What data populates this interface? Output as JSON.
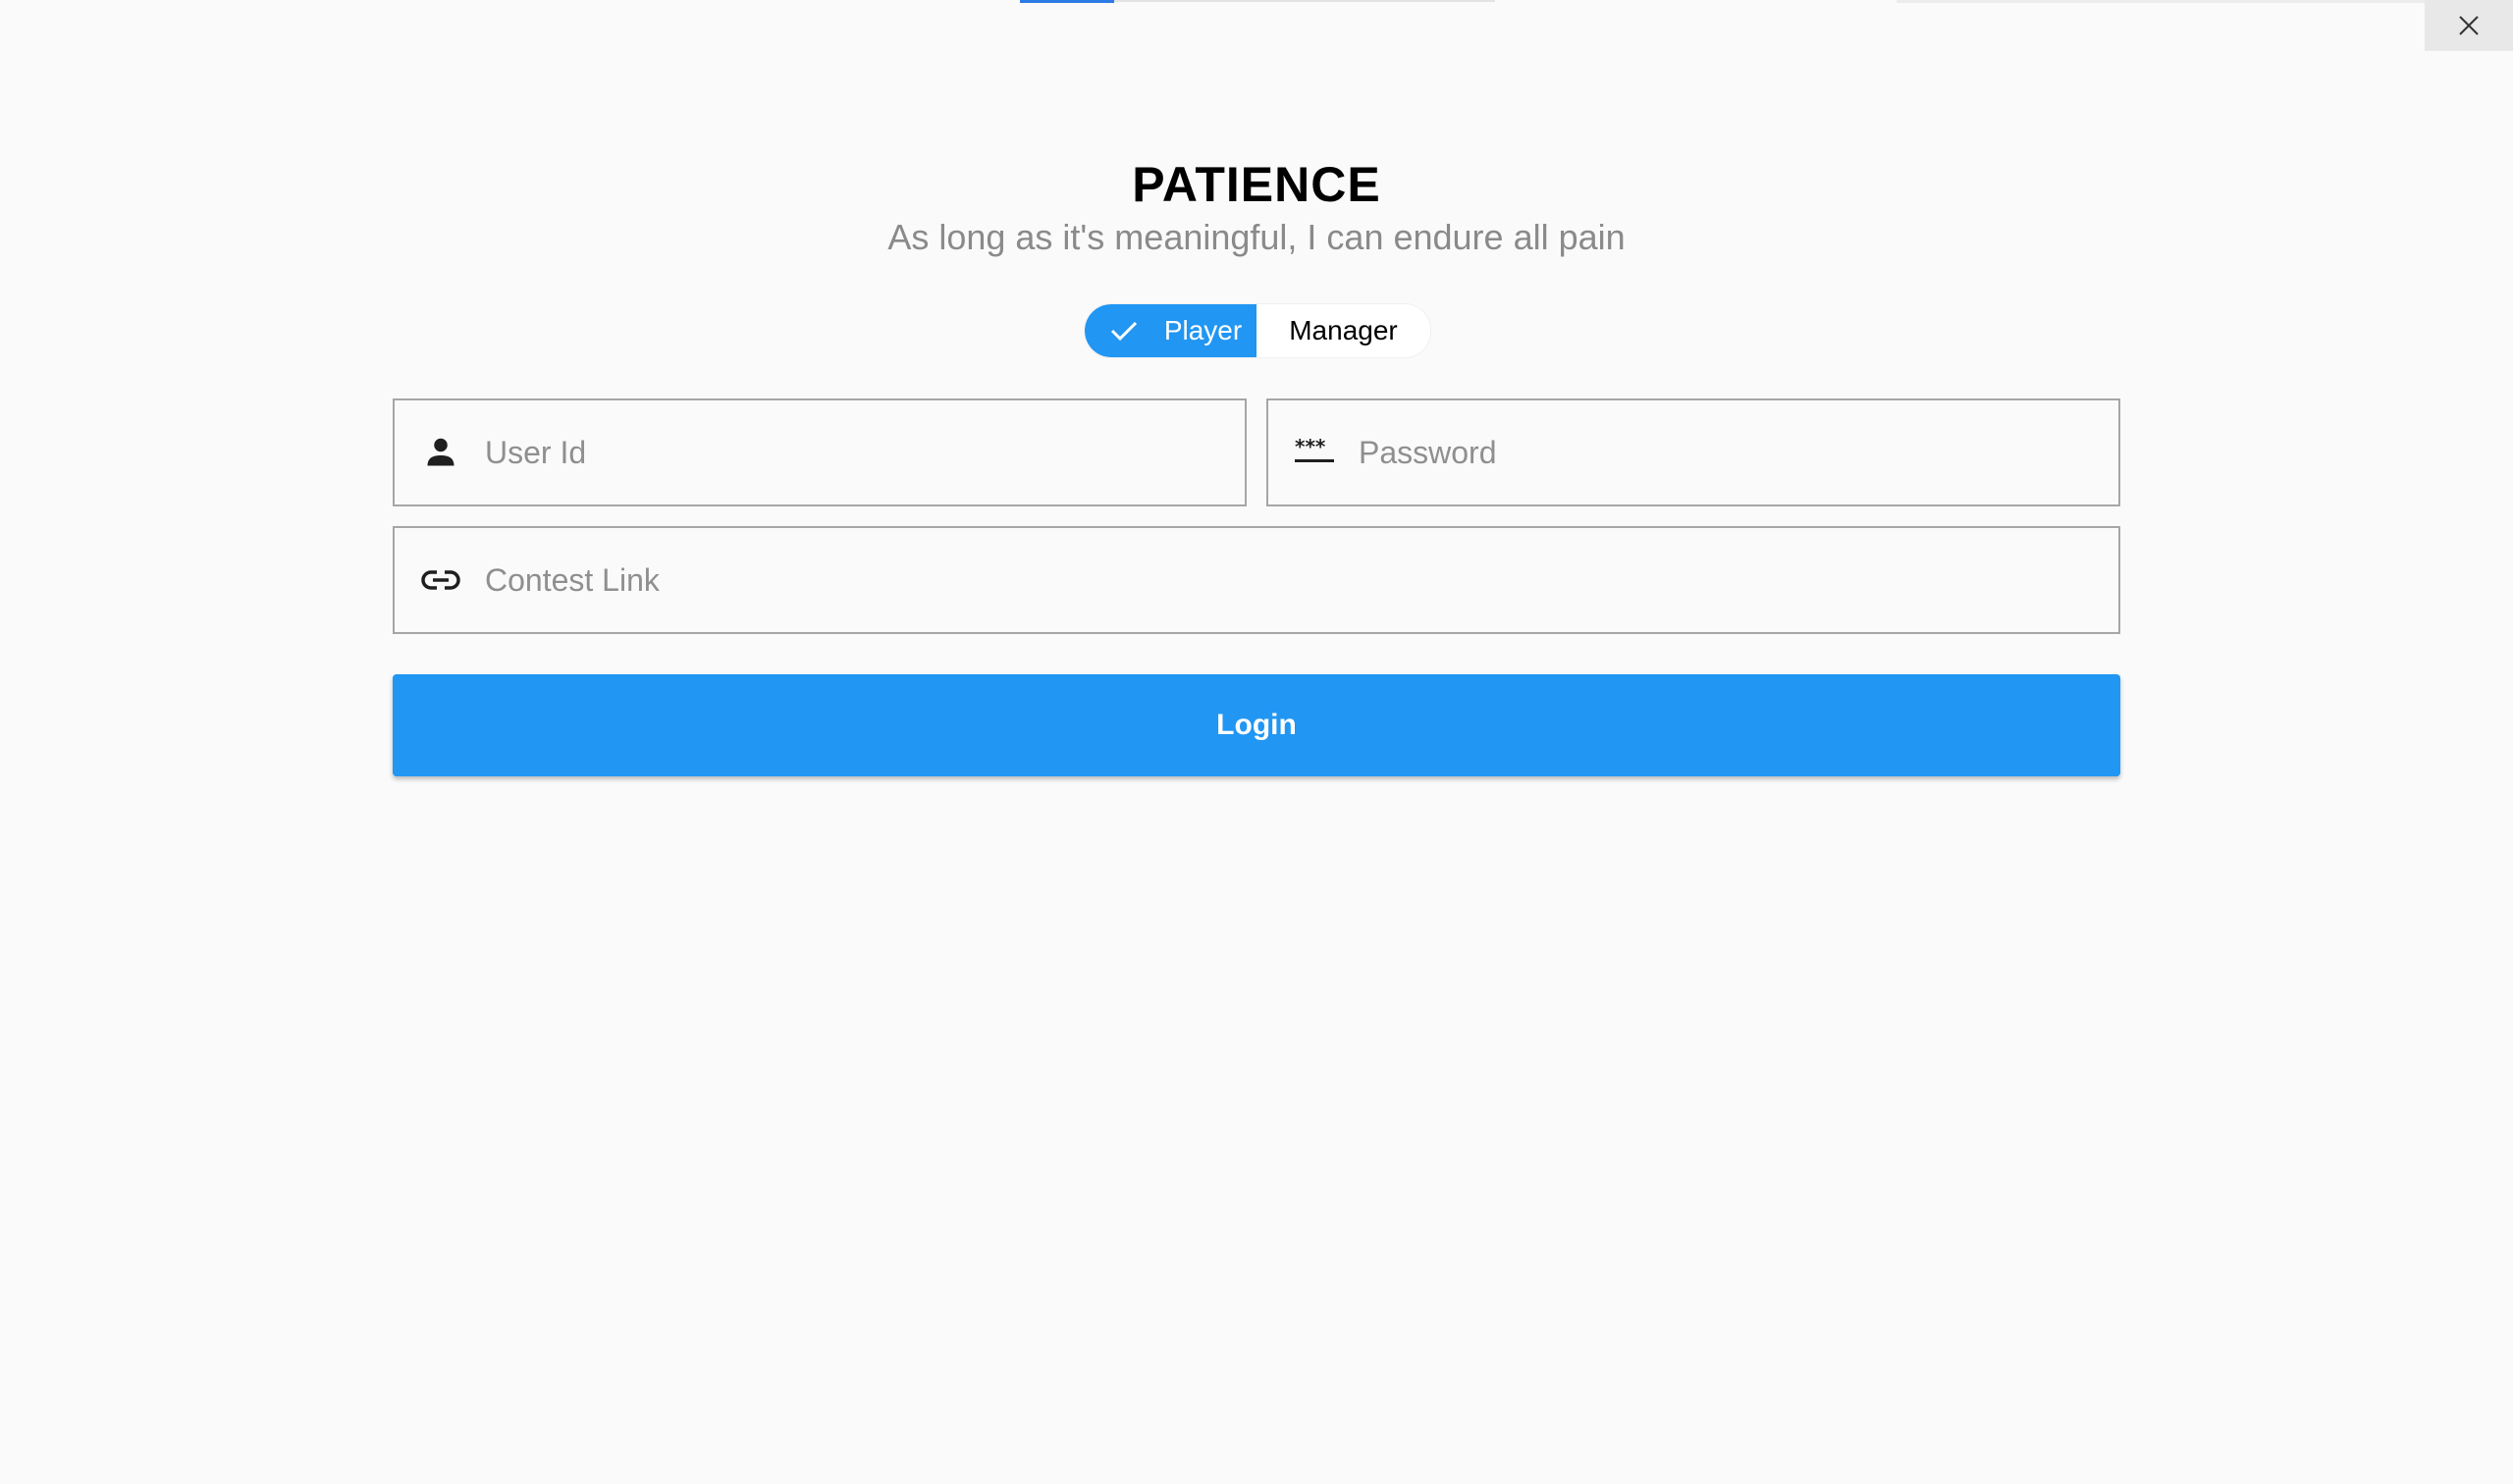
{
  "window": {
    "close_icon": "close-icon"
  },
  "header": {
    "title": "PATIENCE",
    "subtitle": "As long as it's meaningful, I can endure all pain"
  },
  "role_toggle": {
    "options": [
      {
        "label": "Player",
        "selected": true,
        "icon": "check-icon"
      },
      {
        "label": "Manager",
        "selected": false
      }
    ]
  },
  "form": {
    "user_id": {
      "placeholder": "User Id",
      "value": "",
      "icon": "person-icon"
    },
    "password": {
      "placeholder": "Password",
      "value": "",
      "icon": "password-icon"
    },
    "contest_link": {
      "placeholder": "Contest Link",
      "value": "",
      "icon": "link-icon"
    },
    "login_label": "Login"
  },
  "colors": {
    "accent": "#2196f3",
    "background": "#fafafa",
    "field_border": "#a6a6a6",
    "placeholder": "#8f8f8f"
  }
}
